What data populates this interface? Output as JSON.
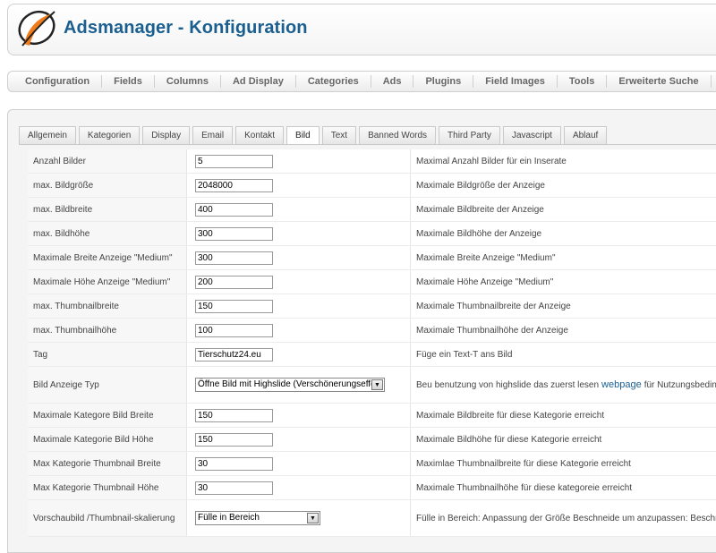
{
  "header": {
    "title": "Adsmanager - Konfiguration"
  },
  "menu": [
    "Configuration",
    "Fields",
    "Columns",
    "Ad Display",
    "Categories",
    "Ads",
    "Plugins",
    "Field Images",
    "Tools",
    "Erweiterte Suche"
  ],
  "tabs": [
    {
      "label": "Allgemein",
      "active": false
    },
    {
      "label": "Kategorien",
      "active": false
    },
    {
      "label": "Display",
      "active": false
    },
    {
      "label": "Email",
      "active": false
    },
    {
      "label": "Kontakt",
      "active": false
    },
    {
      "label": "Bild",
      "active": true
    },
    {
      "label": "Text",
      "active": false
    },
    {
      "label": "Banned Words",
      "active": false
    },
    {
      "label": "Third Party",
      "active": false
    },
    {
      "label": "Javascript",
      "active": false
    },
    {
      "label": "Ablauf",
      "active": false
    }
  ],
  "rows": [
    {
      "label": "Anzahl Bilder",
      "value": "5",
      "desc": "Maximal Anzahl Bilder für ein Inserate"
    },
    {
      "label": "max. Bildgröße",
      "value": "2048000",
      "desc": "Maximale Bildgröße der Anzeige"
    },
    {
      "label": "max. Bildbreite",
      "value": "400",
      "desc": "Maximale Bildbreite der Anzeige"
    },
    {
      "label": "max. Bildhöhe",
      "value": "300",
      "desc": "Maximale Bildhöhe der Anzeige"
    },
    {
      "label": "Maximale Breite Anzeige \"Medium\"",
      "value": "300",
      "desc": "Maximale Breite Anzeige \"Medium\""
    },
    {
      "label": "Maximale Höhe Anzeige \"Medium\"",
      "value": "200",
      "desc": "Maximale Höhe Anzeige \"Medium\""
    },
    {
      "label": "max. Thumbnailbreite",
      "value": "150",
      "desc": "Maximale Thumbnailbreite der Anzeige"
    },
    {
      "label": "max. Thumbnailhöhe",
      "value": "100",
      "desc": "Maximale Thumbnailhöhe der Anzeige"
    },
    {
      "label": "Tag",
      "value": "Tierschutz24.eu",
      "desc": "Füge ein Text-T ans Bild"
    }
  ],
  "image_type_row": {
    "label": "Bild Anzeige Typ",
    "selected": "Öffne Bild mit Highslide (Verschönerungseffekt",
    "desc_before": "Beu benutzung von highslide das zuerst lesen",
    "desc_link": "webpage",
    "desc_after": "für Nutzungsbedingungen"
  },
  "rows2": [
    {
      "label": "Maximale Kategore Bild Breite",
      "value": "150",
      "desc": "Maximale Bildbreite für diese Kategorie erreicht"
    },
    {
      "label": "Maximale Kategorie Bild Höhe",
      "value": "150",
      "desc": "Maximale Bildhöhe für diese Kategorie erreicht"
    },
    {
      "label": "Max Kategorie Thumbnail Breite",
      "value": "30",
      "desc": "Maximlae Thumbnailbreite für diese Kategorie erreicht"
    },
    {
      "label": "Max Kategorie Thumbnail Höhe",
      "value": "30",
      "desc": "Maximale Thumbnailhöhe für diese kategoreie erreicht"
    }
  ],
  "scaling_row": {
    "label": "Vorschaubild /Thumbnail-skalierung",
    "selected": "Fülle in Bereich",
    "desc": "Fülle in Bereich: Anpassung der Größe Beschneide um anzupassen: Beschneide"
  },
  "colors": {
    "title": "#1a5f8f",
    "logo_orange": "#f07c1a",
    "logo_dark": "#222222"
  },
  "icons": {
    "logo": "adsmanager-logo",
    "dropdown": "chevron-down-icon"
  }
}
